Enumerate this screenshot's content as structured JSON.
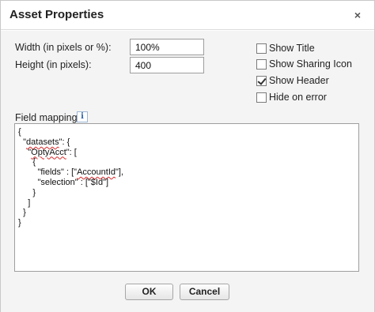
{
  "dialog": {
    "title": "Asset Properties",
    "close_symbol": "×"
  },
  "form": {
    "width_label": "Width (in pixels or %):",
    "width_value": "100%",
    "height_label": "Height (in pixels):",
    "height_value": "400",
    "field_mapping_label": "Field mapping",
    "info_symbol": "i"
  },
  "options": [
    {
      "label": "Show Title",
      "checked": false
    },
    {
      "label": "Show Sharing Icon",
      "checked": false
    },
    {
      "label": "Show Header",
      "checked": true
    },
    {
      "label": "Hide on error",
      "checked": false
    }
  ],
  "editor": {
    "lines": [
      [
        {
          "t": "{"
        }
      ],
      [
        {
          "t": "  \""
        },
        {
          "t": "datasets",
          "spell": true
        },
        {
          "t": "\": {"
        }
      ],
      [
        {
          "t": "    \""
        },
        {
          "t": "OptyAcct",
          "spell": true
        },
        {
          "t": "\": ["
        }
      ],
      [
        {
          "t": "      {"
        }
      ],
      [
        {
          "t": "        \"fields\" : [\""
        },
        {
          "t": "AccountId",
          "spell": true
        },
        {
          "t": "\"],"
        }
      ],
      [
        {
          "t": "        \"selection\" : [\"$Id\"]"
        }
      ],
      [
        {
          "t": "      }"
        }
      ],
      [
        {
          "t": "    ]"
        }
      ],
      [
        {
          "t": "  }"
        }
      ],
      [
        {
          "t": "}"
        }
      ]
    ]
  },
  "buttons": {
    "ok": "OK",
    "cancel": "Cancel"
  }
}
